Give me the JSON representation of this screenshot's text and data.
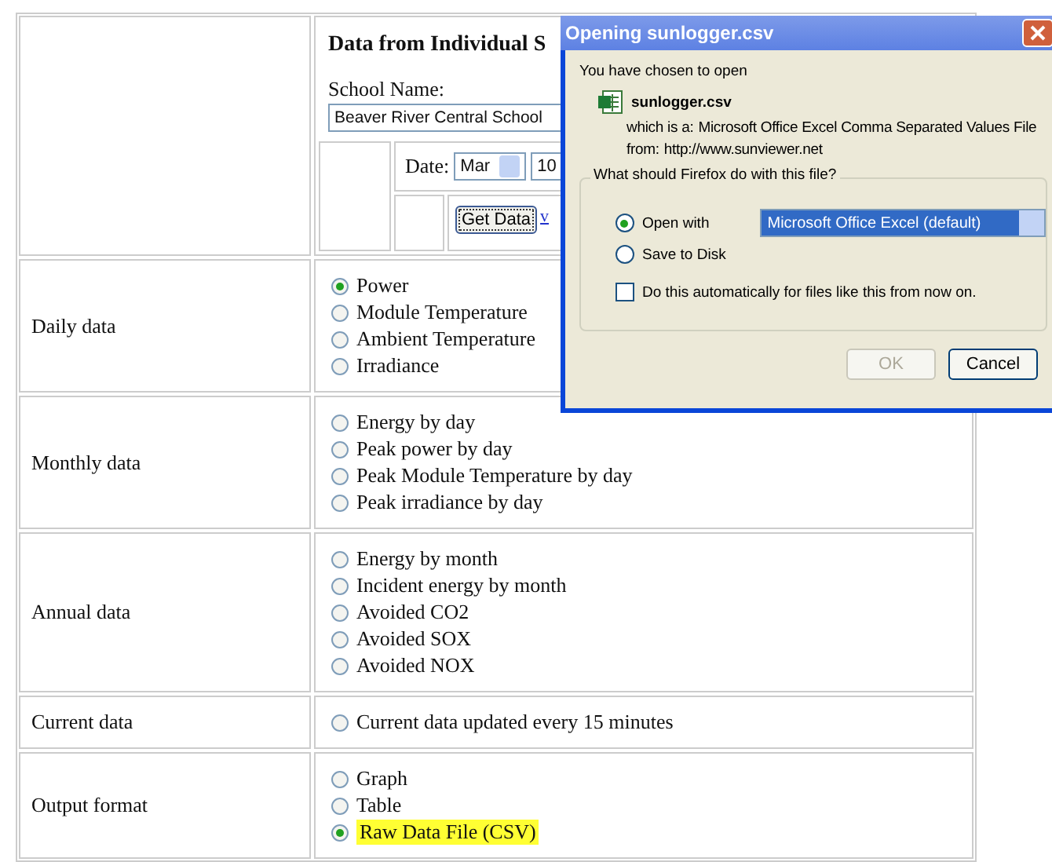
{
  "page": {
    "title": "Data from Individual S",
    "school_label": "School Name:",
    "school_value": "Beaver River Central School",
    "date_label": "Date:",
    "month": "Mar",
    "day": "10",
    "get_data": "Get Data",
    "link": "v"
  },
  "sections": [
    {
      "label": "Daily data",
      "options": [
        {
          "label": "Power",
          "selected": true,
          "highlighted": false
        },
        {
          "label": "Module Temperature",
          "selected": false,
          "highlighted": false
        },
        {
          "label": "Ambient Temperature",
          "selected": false,
          "highlighted": false
        },
        {
          "label": "Irradiance",
          "selected": false,
          "highlighted": false
        }
      ]
    },
    {
      "label": "Monthly data",
      "options": [
        {
          "label": "Energy by day",
          "selected": false,
          "highlighted": false
        },
        {
          "label": "Peak power by day",
          "selected": false,
          "highlighted": false
        },
        {
          "label": "Peak Module Temperature by day",
          "selected": false,
          "highlighted": false
        },
        {
          "label": "Peak irradiance by day",
          "selected": false,
          "highlighted": false
        }
      ]
    },
    {
      "label": "Annual data",
      "options": [
        {
          "label": "Energy by month",
          "selected": false,
          "highlighted": false
        },
        {
          "label": "Incident energy by month",
          "selected": false,
          "highlighted": false
        },
        {
          "label": "Avoided CO2",
          "selected": false,
          "highlighted": false
        },
        {
          "label": "Avoided SOX",
          "selected": false,
          "highlighted": false
        },
        {
          "label": "Avoided NOX",
          "selected": false,
          "highlighted": false
        }
      ]
    },
    {
      "label": "Current data",
      "options": [
        {
          "label": "Current data updated every 15 minutes",
          "selected": false,
          "highlighted": false
        }
      ]
    },
    {
      "label": "Output format",
      "options": [
        {
          "label": "Graph",
          "selected": false,
          "highlighted": false
        },
        {
          "label": "Table",
          "selected": false,
          "highlighted": false
        },
        {
          "label": "Raw Data File (CSV)",
          "selected": true,
          "highlighted": true
        }
      ]
    }
  ],
  "dialog": {
    "title": "Opening sunlogger.csv",
    "intro": "You have chosen to open",
    "filename": "sunlogger.csv",
    "type_label": "which is a:",
    "type_value": "Microsoft Office Excel Comma Separated Values File",
    "from_label": "from:",
    "from_value": "http://www.sunviewer.net",
    "group_title": "What should Firefox do with this file?",
    "actions": [
      {
        "label": "Open with",
        "selected": true
      },
      {
        "label": "Save to Disk",
        "selected": false
      }
    ],
    "app_select": "Microsoft Office Excel (default)",
    "auto_checkbox": {
      "label": "Do this automatically for files like this from now on.",
      "checked": false
    },
    "buttons": [
      {
        "label": "OK",
        "disabled": true
      },
      {
        "label": "Cancel",
        "disabled": false
      }
    ]
  }
}
